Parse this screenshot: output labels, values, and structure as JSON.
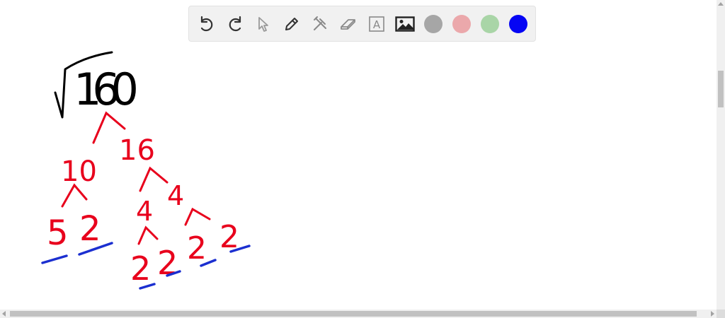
{
  "toolbar": {
    "tools": [
      {
        "name": "undo-icon"
      },
      {
        "name": "redo-icon"
      },
      {
        "name": "select-cursor-icon"
      },
      {
        "name": "pencil-icon"
      },
      {
        "name": "tools-icon"
      },
      {
        "name": "eraser-icon"
      },
      {
        "name": "text-icon",
        "glyph": "A"
      },
      {
        "name": "image-icon"
      }
    ],
    "colors": {
      "gray": "#a6a6a6",
      "pink": "#eba8ab",
      "green": "#a9d5a7",
      "blue": "#0505f4"
    }
  },
  "drawing": {
    "ink_black": "#000000",
    "ink_red": "#e8001c",
    "ink_blue": "#1b2fd0",
    "radicand": "160",
    "factor_left": "10",
    "factor_right": "16",
    "row2": [
      "5",
      "2",
      "4",
      "4"
    ],
    "row3": [
      "2",
      "2",
      "2",
      "2"
    ]
  }
}
